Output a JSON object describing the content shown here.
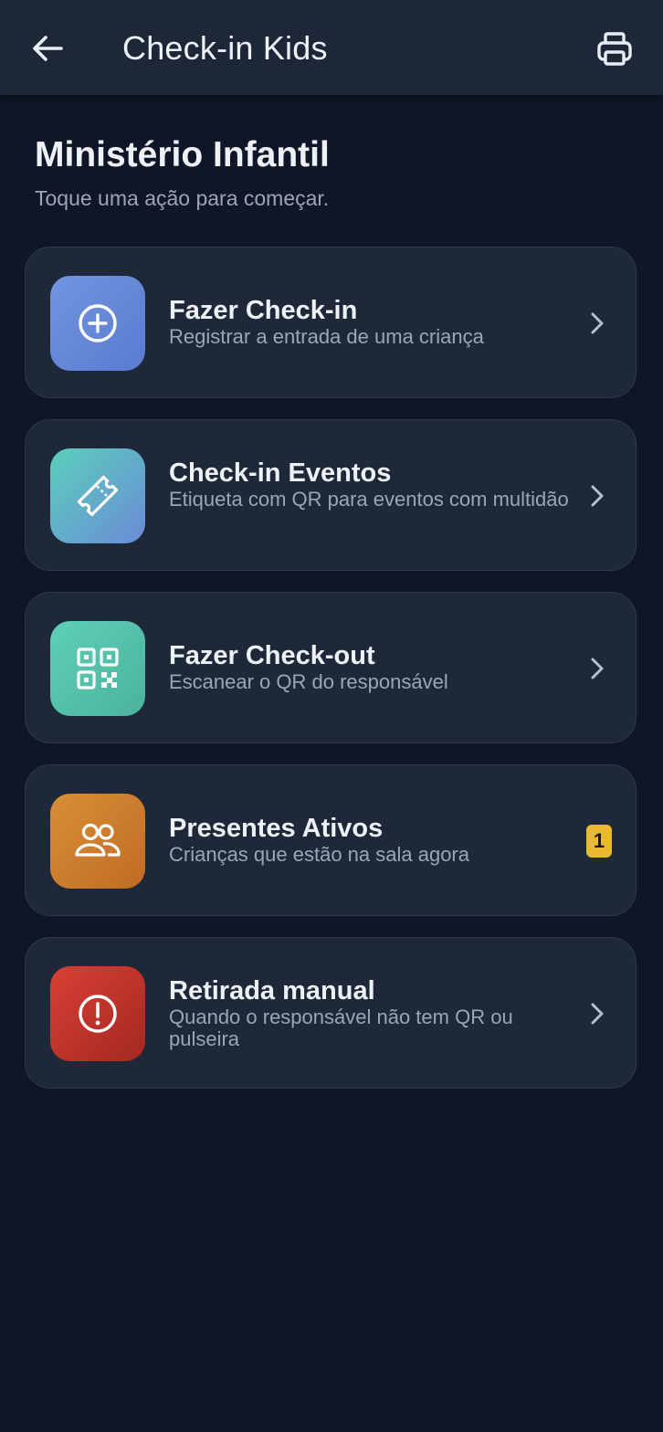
{
  "header": {
    "title": "Check-in Kids",
    "back_icon": "arrow-left-icon",
    "print_icon": "printer-icon"
  },
  "page": {
    "heading": "Ministério Infantil",
    "subtitle": "Toque uma ação para começar."
  },
  "actions": [
    {
      "title": "Fazer Check-in",
      "description": "Registrar a entrada de uma criança",
      "icon": "plus-circle-icon",
      "colors": [
        "#6f8fdc",
        "#5b7dd0"
      ]
    },
    {
      "title": "Check-in Eventos",
      "description": "Etiqueta com QR para eventos com multidão",
      "icon": "ticket-icon",
      "colors": [
        "#5ccdbc",
        "#6a8cd6"
      ]
    },
    {
      "title": "Fazer Check-out",
      "description": "Escanear o QR do responsável",
      "icon": "qr-code-icon",
      "colors": [
        "#5bcab4",
        "#4db59e"
      ]
    },
    {
      "title": "Presentes Ativos",
      "description": "Crianças que estão na sala agora",
      "icon": "users-icon",
      "colors": [
        "#d58a35",
        "#c06e25"
      ],
      "badge": "1"
    },
    {
      "title": "Retirada manual",
      "description": "Quando o responsável não tem QR ou pulseira",
      "icon": "alert-circle-icon",
      "colors": [
        "#d63c32",
        "#a82a24"
      ]
    }
  ],
  "colors": {
    "background": "#0f1627",
    "card": "#1f2838",
    "topbar": "#1e2738",
    "badge": "#e9b930"
  }
}
